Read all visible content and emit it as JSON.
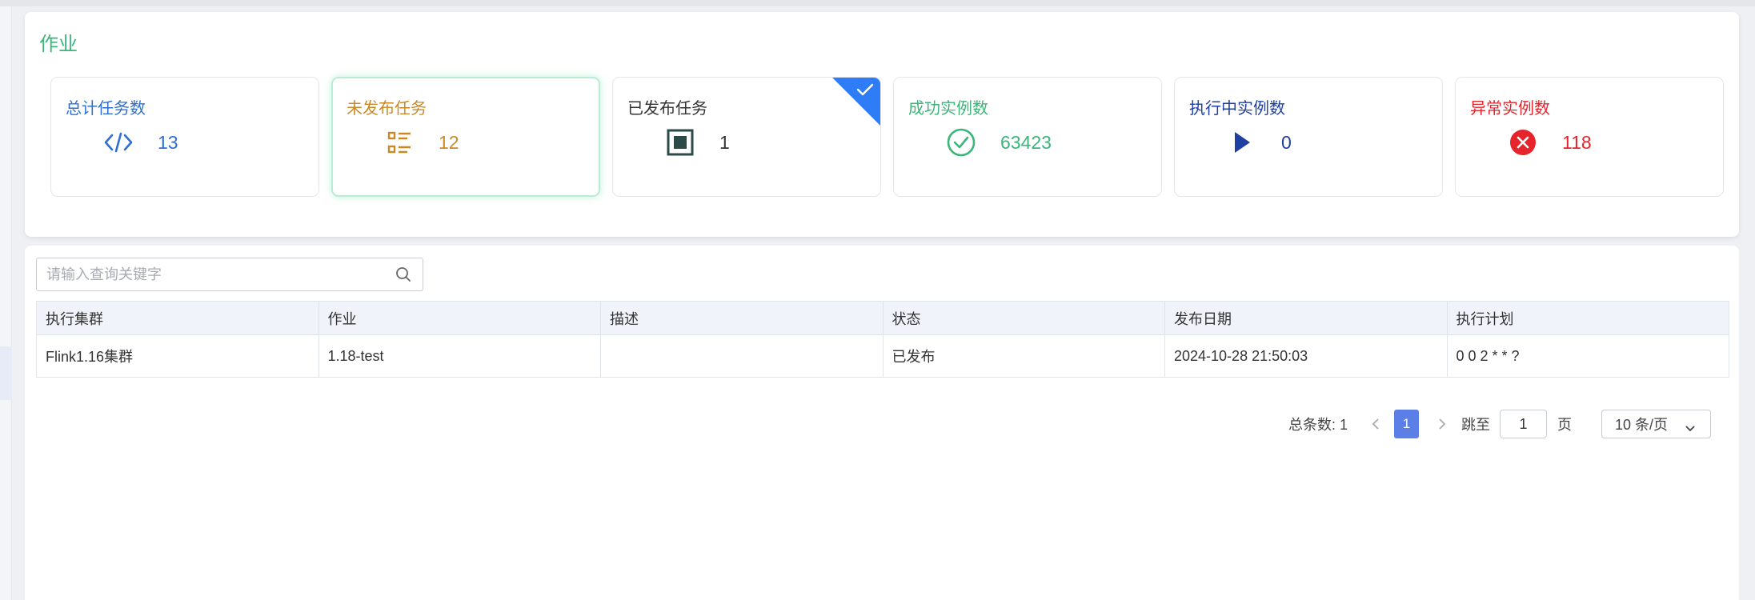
{
  "section": {
    "title": "作业"
  },
  "stats": [
    {
      "label": "总计任务数",
      "value": "13",
      "color": "#2f6fd1",
      "icon": "code-icon",
      "selected": false,
      "published_badge": false
    },
    {
      "label": "未发布任务",
      "value": "12",
      "color": "#c98a26",
      "icon": "list-icon",
      "selected": true,
      "published_badge": false
    },
    {
      "label": "已发布任务",
      "value": "1",
      "color": "#333333",
      "icon": "stop-square-icon",
      "selected": false,
      "published_badge": true
    },
    {
      "label": "成功实例数",
      "value": "63423",
      "color": "#3cb57a",
      "icon": "check-circle-icon",
      "selected": false,
      "published_badge": false
    },
    {
      "label": "执行中实例数",
      "value": "0",
      "color": "#1f3fa3",
      "icon": "play-icon",
      "selected": false,
      "published_badge": false
    },
    {
      "label": "异常实例数",
      "value": "118",
      "color": "#e5242c",
      "icon": "close-circle-icon",
      "selected": false,
      "published_badge": false
    }
  ],
  "search": {
    "placeholder": "请输入查询关键字",
    "value": ""
  },
  "table": {
    "columns": [
      "执行集群",
      "作业",
      "描述",
      "状态",
      "发布日期",
      "执行计划"
    ],
    "rows": [
      {
        "cluster": "Flink1.16集群",
        "job": "1.18-test",
        "description": "",
        "status": "已发布",
        "published_at": "2024-10-28 21:50:03",
        "schedule": "0 0 2 * * ?"
      }
    ]
  },
  "pagination": {
    "total_label": "总条数: 1",
    "current_page": "1",
    "goto_label": "跳至",
    "goto_value": "1",
    "page_unit": "页",
    "page_size": "10 条/页"
  },
  "colors": {
    "accent_green": "#3cb57a",
    "primary_blue": "#5b7fe6",
    "badge_blue": "#2f7df6"
  }
}
